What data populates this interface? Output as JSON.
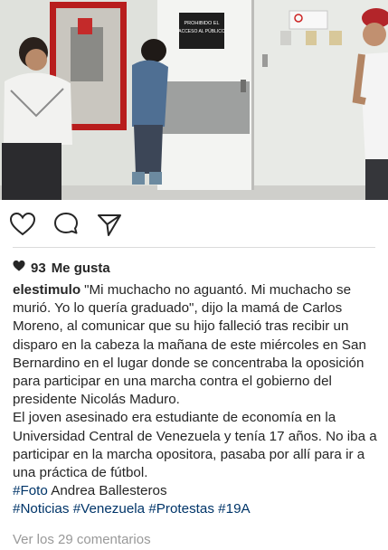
{
  "post": {
    "likes_count": "93",
    "likes_label": "Me gusta",
    "username": "elestimulo",
    "caption_p1": "\"Mi muchacho no aguantó. Mi muchacho se murió. Yo lo quería graduado\", dijo la mamá de Carlos Moreno, al comunicar que su hijo falleció tras recibir un disparo en la cabeza la mañana de este miércoles en San Bernardino en el lugar donde se concentraba la oposición para participar en una marcha contra el gobierno del presidente Nicolás Maduro.",
    "caption_p2": "El joven asesinado era estudiante de economía en la Universidad Central de Venezuela y tenía 17 años. No iba a participar en la marcha opositora, pasaba por allí para ir a una práctica de fútbol.",
    "photo_credit_tag": "#Foto",
    "photo_credit_name": "Andrea Ballesteros",
    "hashtags": [
      "#Noticias",
      "#Venezuela",
      "#Protestas",
      "#19A"
    ],
    "view_comments": "Ver los 29 comentarios"
  },
  "photo": {
    "sign_text": [
      "PROHIBIDO EL",
      "ACCESO AL PÚBLICO"
    ]
  },
  "icons": {
    "like": "heart-icon",
    "comment": "speech-bubble-icon",
    "share": "paper-plane-icon",
    "likes_heart": "filled-heart-icon"
  }
}
